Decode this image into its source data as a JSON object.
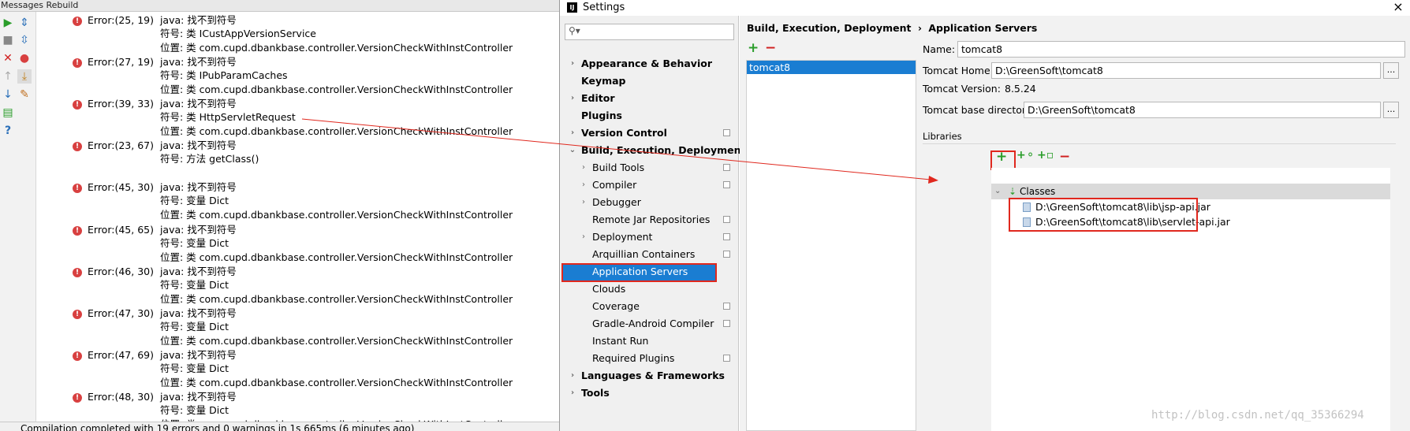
{
  "messages": {
    "title": "Messages Rebuild",
    "status": "Compilation completed with 19 errors and 0 warnings in 1s 665ms (6 minutes ago)",
    "errors": [
      {
        "loc": "Error:(25, 19)",
        "msg": "java: 找不到符号",
        "sym": "符号:   类 ICustAppVersionService",
        "pos": "位置: 类 com.cupd.dbankbase.controller.VersionCheckWithInstController"
      },
      {
        "loc": "Error:(27, 19)",
        "msg": "java: 找不到符号",
        "sym": "符号:   类 IPubParamCaches",
        "pos": "位置: 类 com.cupd.dbankbase.controller.VersionCheckWithInstController"
      },
      {
        "loc": "Error:(39, 33)",
        "msg": "java: 找不到符号",
        "sym": "符号:   类 HttpServletRequest",
        "pos": "位置: 类 com.cupd.dbankbase.controller.VersionCheckWithInstController"
      },
      {
        "loc": "Error:(23, 67)",
        "msg": "java: 找不到符号",
        "sym": "符号: 方法 getClass()",
        "pos": ""
      },
      {
        "loc": "Error:(45, 30)",
        "msg": "java: 找不到符号",
        "sym": "符号:   变量 Dict",
        "pos": "位置: 类 com.cupd.dbankbase.controller.VersionCheckWithInstController"
      },
      {
        "loc": "Error:(45, 65)",
        "msg": "java: 找不到符号",
        "sym": "符号:   变量 Dict",
        "pos": "位置: 类 com.cupd.dbankbase.controller.VersionCheckWithInstController"
      },
      {
        "loc": "Error:(46, 30)",
        "msg": "java: 找不到符号",
        "sym": "符号:   变量 Dict",
        "pos": "位置: 类 com.cupd.dbankbase.controller.VersionCheckWithInstController"
      },
      {
        "loc": "Error:(47, 30)",
        "msg": "java: 找不到符号",
        "sym": "符号:   变量 Dict",
        "pos": "位置: 类 com.cupd.dbankbase.controller.VersionCheckWithInstController"
      },
      {
        "loc": "Error:(47, 69)",
        "msg": "java: 找不到符号",
        "sym": "符号:   变量 Dict",
        "pos": "位置: 类 com.cupd.dbankbase.controller.VersionCheckWithInstController"
      },
      {
        "loc": "Error:(48, 30)",
        "msg": "java: 找不到符号",
        "sym": "符号:   变量 Dict",
        "pos": "位置: 类 com.cupd.dbankbase.controller.VersionCheckWithInstController"
      }
    ]
  },
  "settings": {
    "title": "Settings",
    "close": "×",
    "logo": "IJ",
    "search_placeholder": "",
    "tree": [
      {
        "label": "Appearance & Behavior",
        "bold": true,
        "level": 0,
        "arrow": "›"
      },
      {
        "label": "Keymap",
        "bold": true,
        "level": 0,
        "arrow": ""
      },
      {
        "label": "Editor",
        "bold": true,
        "level": 0,
        "arrow": "›"
      },
      {
        "label": "Plugins",
        "bold": true,
        "level": 0,
        "arrow": ""
      },
      {
        "label": "Version Control",
        "bold": true,
        "level": 0,
        "arrow": "›",
        "cfg": true
      },
      {
        "label": "Build, Execution, Deployment",
        "bold": true,
        "level": 0,
        "arrow": "⌄"
      },
      {
        "label": "Build Tools",
        "bold": false,
        "level": 1,
        "arrow": "›",
        "cfg": true
      },
      {
        "label": "Compiler",
        "bold": false,
        "level": 1,
        "arrow": "›",
        "cfg": true
      },
      {
        "label": "Debugger",
        "bold": false,
        "level": 1,
        "arrow": "›"
      },
      {
        "label": "Remote Jar Repositories",
        "bold": false,
        "level": 1,
        "arrow": "",
        "cfg": true
      },
      {
        "label": "Deployment",
        "bold": false,
        "level": 1,
        "arrow": "›",
        "cfg": true
      },
      {
        "label": "Arquillian Containers",
        "bold": false,
        "level": 1,
        "arrow": "",
        "cfg": true
      },
      {
        "label": "Application Servers",
        "bold": false,
        "level": 1,
        "arrow": "",
        "selected": true
      },
      {
        "label": "Clouds",
        "bold": false,
        "level": 1,
        "arrow": ""
      },
      {
        "label": "Coverage",
        "bold": false,
        "level": 1,
        "arrow": "",
        "cfg": true
      },
      {
        "label": "Gradle-Android Compiler",
        "bold": false,
        "level": 1,
        "arrow": "",
        "cfg": true
      },
      {
        "label": "Instant Run",
        "bold": false,
        "level": 1,
        "arrow": ""
      },
      {
        "label": "Required Plugins",
        "bold": false,
        "level": 1,
        "arrow": "",
        "cfg": true
      },
      {
        "label": "Languages & Frameworks",
        "bold": true,
        "level": 0,
        "arrow": "›"
      },
      {
        "label": "Tools",
        "bold": true,
        "level": 0,
        "arrow": "›"
      }
    ],
    "breadcrumb": {
      "parent": "Build, Execution, Deployment",
      "sep": "›",
      "current": "Application Servers"
    },
    "servers": [
      "tomcat8"
    ],
    "form": {
      "name_label": "Name:",
      "name_value": "tomcat8",
      "home_label": "Tomcat Home:",
      "home_value": "D:\\GreenSoft\\tomcat8",
      "version_label": "Tomcat Version:",
      "version_value": "8.5.24",
      "base_label": "Tomcat base directory:",
      "base_value": "D:\\GreenSoft\\tomcat8",
      "browse": "..."
    },
    "libraries": {
      "label": "Libraries",
      "classes": "Classes",
      "jars": [
        "D:\\GreenSoft\\tomcat8\\lib\\jsp-api.jar",
        "D:\\GreenSoft\\tomcat8\\lib\\servlet-api.jar"
      ]
    }
  },
  "watermark": "http://blog.csdn.net/qq_35366294",
  "colors": {
    "selection": "#1a7dd2",
    "annotation": "#e0281e",
    "error": "#d84040",
    "add": "#2a9d2a",
    "remove": "#d02020"
  }
}
